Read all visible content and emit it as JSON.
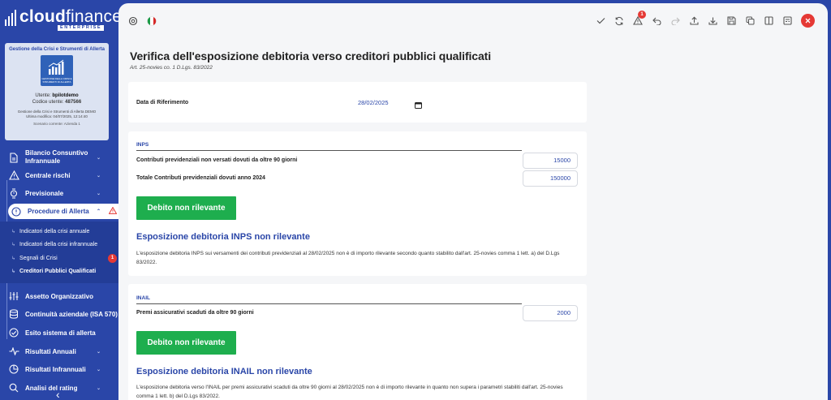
{
  "brand": {
    "name_bold": "cloud",
    "name_light": "finance",
    "edition": "ENTERPRISE"
  },
  "colors": {
    "primary": "#2a46a8",
    "success": "#1eae4e",
    "danger": "#e53935",
    "background": "#f5f6f8"
  },
  "user_card": {
    "title": "Gestione della Crisi e Strumenti di Allerta",
    "image_caption": "GESTIONE DELLA CRISI E STRUMENTI DI ALLERTA",
    "user_label": "Utente:",
    "user_value": "bpilotdemo",
    "code_label": "Codice utente:",
    "code_value": "487566",
    "info_line1": "Gestione della Crisi e Strumenti di Allerta DEMO",
    "info_line2": "Ultima modifica: 04/07/2025, 12:14:40",
    "scenario": "Scenario corrente: Azienda 1"
  },
  "sidebar": {
    "items": [
      {
        "label_line1": "Bilancio Consuntivo",
        "label_line2": "Infrannuale",
        "icon": "document-icon"
      },
      {
        "label": "Centrale rischi",
        "icon": "warning-icon"
      },
      {
        "label": "Previsionale",
        "icon": "watch-icon"
      },
      {
        "label": "Procedure di Allerta",
        "icon": "alert-circle-icon",
        "active": true
      },
      {
        "label": "Assetto Organizzativo",
        "icon": "sliders-icon"
      },
      {
        "label": "Continuità aziendale (ISA 570)",
        "icon": "database-icon"
      },
      {
        "label": "Esito sistema di allerta",
        "icon": "check-circle-icon"
      },
      {
        "label": "Risultati Annuali",
        "icon": "pulse-icon"
      },
      {
        "label": "Risultati Infrannuali",
        "icon": "pie-icon"
      },
      {
        "label": "Analisi del rating",
        "icon": "search-icon"
      }
    ],
    "sub_items": [
      {
        "label": "Indicatori della crisi annuale"
      },
      {
        "label": "Indicatori della crisi infrannuale"
      },
      {
        "label": "Segnali di Crisi",
        "badge": "1"
      },
      {
        "label": "Creditori Pubblici Qualificati",
        "active": true
      }
    ]
  },
  "topbar": {
    "alerts_badge": "1"
  },
  "page": {
    "title": "Verifica dell'esposizione debitoria verso creditori pubblici qualificati",
    "subtitle": "Art. 25-novies co. 1 D.Lgs. 83/2022"
  },
  "date_panel": {
    "label": "Data di Riferimento",
    "value": "28/02/2025"
  },
  "inps": {
    "heading": "INPS",
    "row1_label": "Contributi previdenziali non versati dovuti da oltre 90 giorni",
    "row1_value": "15000",
    "row2_label": "Totale Contributi previdenziali dovuti anno 2024",
    "row2_value": "150000",
    "button": "Debito non rilevante",
    "result_title": "Esposizione debitoria INPS non rilevante",
    "result_text": "L'esposizione debitoria INPS sui versamenti dei contributi previdenziali al 28/02/2025 non è di importo rilevante secondo quanto stabilito dall'art. 25-novies comma 1 lett. a) del D.Lgs 83/2022."
  },
  "inail": {
    "heading": "INAIL",
    "row1_label": "Premi assicurativi scaduti da oltre 90 giorni",
    "row1_value": "2000",
    "button": "Debito non rilevante",
    "result_title": "Esposizione debitoria INAIL non rilevante",
    "result_text": "L'esposizione debitoria verso l'INAIL per premi assicurativi scaduti da oltre 90 giorni al 28/02/2025 non è di importo rilevante in quanto non supera i parametri stabiliti dall'art. 25-novies comma 1 lett. b) del D.Lgs 83/2022."
  }
}
